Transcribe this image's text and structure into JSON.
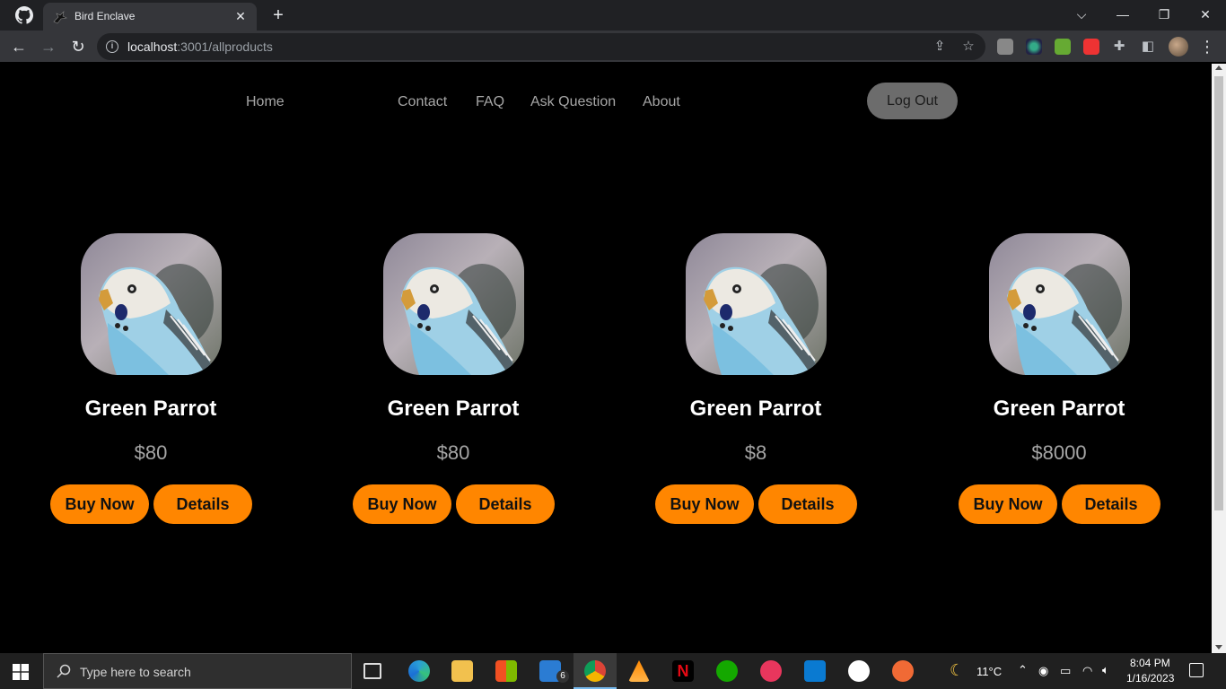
{
  "browser": {
    "tab_title": "Bird Enclave",
    "url_host": "localhost",
    "url_rest": ":3001/allproducts"
  },
  "nav": {
    "links": [
      "Home",
      "Contact",
      "FAQ",
      "Ask Question",
      "About"
    ],
    "logout_label": "Log Out"
  },
  "products": [
    {
      "name": "Green Parrot",
      "price": "$80",
      "buy_label": "Buy Now",
      "details_label": "Details"
    },
    {
      "name": "Green Parrot",
      "price": "$80",
      "buy_label": "Buy Now",
      "details_label": "Details"
    },
    {
      "name": "Green Parrot",
      "price": "$8",
      "buy_label": "Buy Now",
      "details_label": "Details"
    },
    {
      "name": "Green Parrot",
      "price": "$8000",
      "buy_label": "Buy Now",
      "details_label": "Details"
    }
  ],
  "taskbar": {
    "search_placeholder": "Type here to search",
    "mail_badge": "6",
    "weather": "11°C",
    "time": "8:04 PM",
    "date": "1/16/2023"
  },
  "colors": {
    "accent_button": "#ff8600",
    "logout_bg": "#6c6c6c",
    "page_bg": "#000000"
  }
}
